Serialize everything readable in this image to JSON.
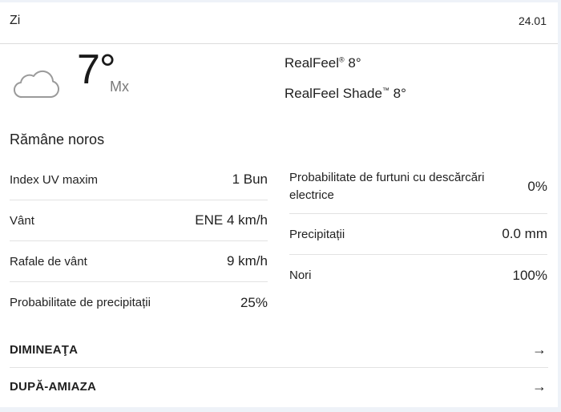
{
  "header": {
    "title": "Zi",
    "date": "24.01"
  },
  "current": {
    "icon": "cloud-icon",
    "temperature": "7°",
    "temperature_unit": "Mx",
    "realfeel_label": "RealFeel",
    "realfeel_mark": "®",
    "realfeel_value": "8°",
    "realfeel_shade_label": "RealFeel Shade",
    "realfeel_shade_mark": "™",
    "realfeel_shade_value": "8°",
    "phrase": "Rămâne noros"
  },
  "details_left": [
    {
      "label": "Index UV maxim",
      "value": "1 Bun"
    },
    {
      "label": "Vânt",
      "value": "ENE 4 km/h"
    },
    {
      "label": "Rafale de vânt",
      "value": "9 km/h"
    },
    {
      "label": "Probabilitate de precipitații",
      "value": "25%"
    }
  ],
  "details_right": [
    {
      "label": "Probabilitate de furtuni cu descărcări electrice",
      "value": "0%"
    },
    {
      "label": "Precipitații",
      "value": "0.0 mm"
    },
    {
      "label": "Nori",
      "value": "100%"
    }
  ],
  "sections": [
    {
      "label": "DIMINEAŢA",
      "icon": "arrow-right-icon",
      "arrow": "→"
    },
    {
      "label": "DUPĂ-AMIAZA",
      "icon": "arrow-right-icon",
      "arrow": "→"
    }
  ],
  "colors": {
    "background": "#eef2f8",
    "card": "#ffffff",
    "divider": "#e2e2e2",
    "icon_stroke": "#9a9a9a"
  }
}
